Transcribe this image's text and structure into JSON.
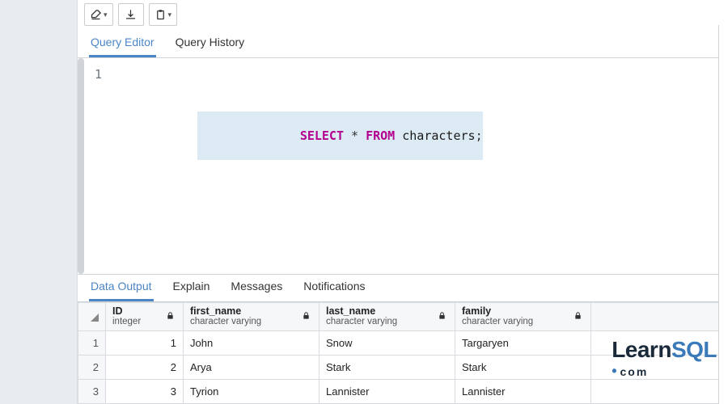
{
  "toolbar": {
    "buttons": [
      "erase",
      "download",
      "paste"
    ]
  },
  "editor_tabs": {
    "items": [
      "Query Editor",
      "Query History"
    ],
    "active_index": 0
  },
  "editor": {
    "line_numbers": [
      "1"
    ],
    "query_tokens": {
      "kw1": "SELECT",
      "star": "*",
      "kw2": "FROM",
      "table": "characters",
      "semi": ";"
    }
  },
  "output_tabs": {
    "items": [
      "Data Output",
      "Explain",
      "Messages",
      "Notifications"
    ],
    "active_index": 0
  },
  "result": {
    "columns": [
      {
        "name": "ID",
        "type": "integer",
        "locked": true
      },
      {
        "name": "first_name",
        "type": "character varying",
        "locked": true
      },
      {
        "name": "last_name",
        "type": "character varying",
        "locked": true
      },
      {
        "name": "family",
        "type": "character varying",
        "locked": true
      }
    ],
    "rows": [
      {
        "n": "1",
        "cells": [
          "1",
          "John",
          "Snow",
          "Targaryen"
        ]
      },
      {
        "n": "2",
        "cells": [
          "2",
          "Arya",
          "Stark",
          "Stark"
        ]
      },
      {
        "n": "3",
        "cells": [
          "3",
          "Tyrion",
          "Lannister",
          "Lannister"
        ]
      }
    ]
  },
  "watermark": {
    "learn": "Learn",
    "sql": "SQL",
    "dotcom": "com"
  }
}
